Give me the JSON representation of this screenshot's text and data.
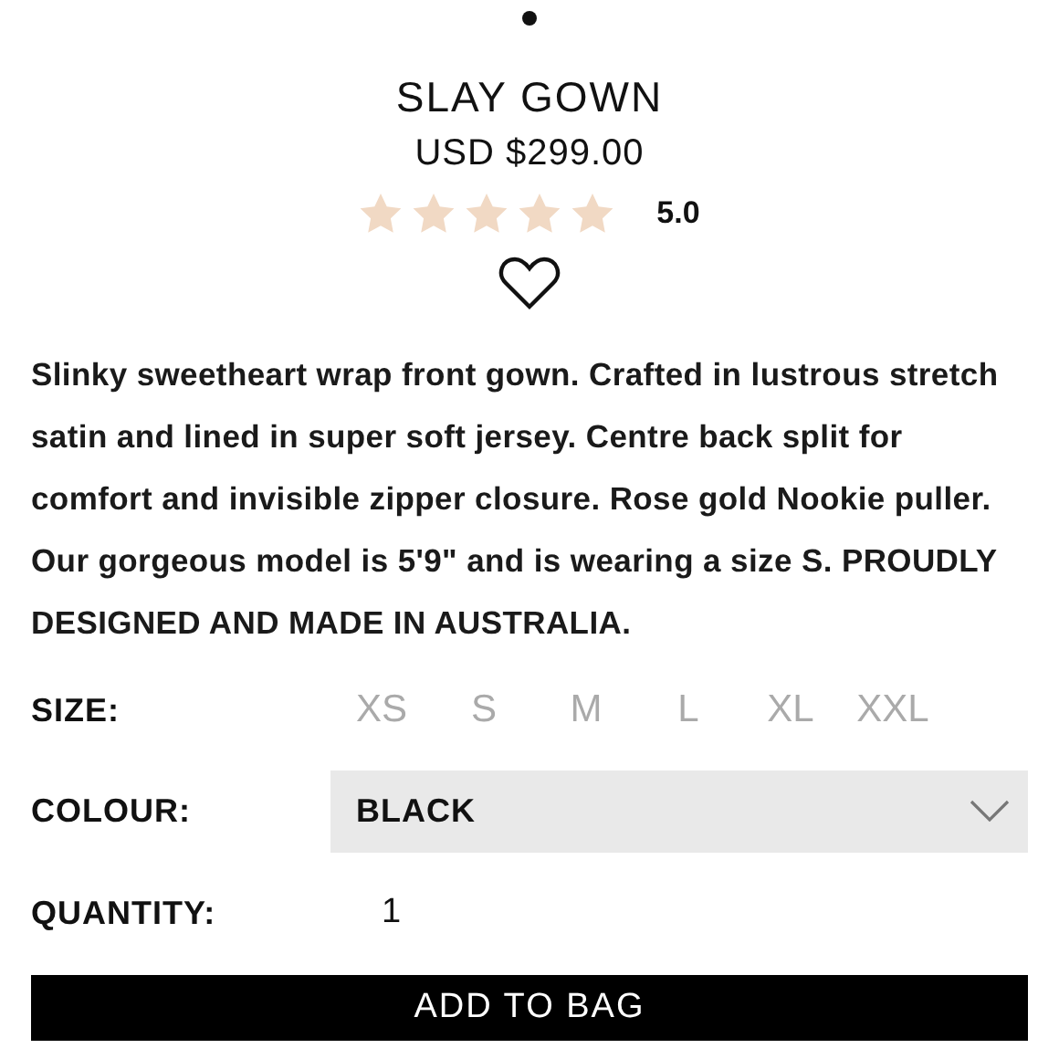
{
  "product": {
    "title": "SLAY GOWN",
    "price": "USD $299.00",
    "stars": 5,
    "rating": "5.0"
  },
  "description": "Slinky sweetheart wrap front gown. Crafted in lustrous stretch satin and lined in super soft jersey. Centre back split for comfort and invisible zipper closure. Rose gold Nookie puller. Our gorgeous model is 5'9\" and is wearing a size S. PROUDLY DESIGNED AND MADE IN AUSTRALIA.",
  "size": {
    "label": "SIZE:",
    "options": [
      {
        "label": "XS",
        "selected": false
      },
      {
        "label": "S",
        "selected": false
      },
      {
        "label": "M",
        "selected": false
      },
      {
        "label": "L",
        "selected": false
      },
      {
        "label": "XL",
        "selected": false
      },
      {
        "label": "XXL",
        "selected": false
      }
    ]
  },
  "colour": {
    "label": "COLOUR:",
    "value": "BLACK"
  },
  "quantity": {
    "label": "QUANTITY:",
    "value": "1"
  },
  "add_button": "ADD TO BAG"
}
